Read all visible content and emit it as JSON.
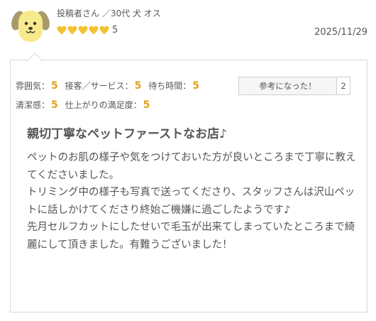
{
  "author": {
    "name": "投稿者さん",
    "meta": "／30代 犬 オス"
  },
  "rating": {
    "hearts_filled": 5,
    "hearts_total": 5,
    "value": "5",
    "heart_color": "#f2c230"
  },
  "post_date": "2025/11/29",
  "scores": [
    {
      "label": "雰囲気",
      "value": "5"
    },
    {
      "label": "接客／サービス",
      "value": "5"
    },
    {
      "label": "待ち時間",
      "value": "5"
    },
    {
      "label": "清潔感",
      "value": "5"
    },
    {
      "label": "仕上がりの満足度",
      "value": "5"
    }
  ],
  "helpful": {
    "label": "参考になった！",
    "count": "2"
  },
  "review": {
    "title": "親切丁寧なペットファーストなお店♪",
    "paragraphs": [
      "ペットのお肌の様子や気をつけておいた方が良いところまで丁寧に教えてくださいました。",
      "トリミング中の様子も写真で送ってくださり、スタッフさんは沢山ペットに話しかけてくださり終始ご機嫌に過ごしたようです♪",
      "先月セルフカットにしたせいで毛玉が出来てしまっていたところまで綺麗にして頂きました。有難うございました！"
    ]
  },
  "colors": {
    "score_accent": "#e3a018",
    "avatar_face": "#f7ea8c",
    "avatar_ears": "#a89a6a"
  }
}
